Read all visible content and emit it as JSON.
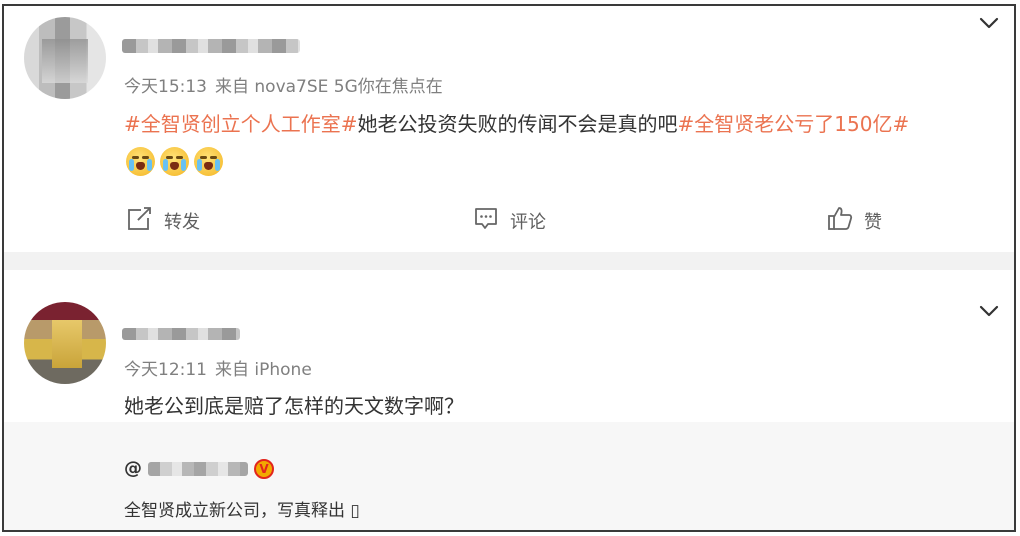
{
  "posts": [
    {
      "meta": {
        "time": "今天15:13",
        "source": "来自 nova7SE 5G你在焦点在"
      },
      "text": {
        "tag1": "#全智贤创立个人工作室#",
        "body": "她老公投资失败的传闻不会是真的吧",
        "tag2": "#全智贤老公亏了150亿#"
      },
      "emojis": [
        "crying-emoji",
        "crying-emoji",
        "crying-emoji"
      ],
      "actions": {
        "repost": "转发",
        "comment": "评论",
        "like": "赞"
      }
    },
    {
      "meta": {
        "time": "今天12:11",
        "source": "来自 iPhone"
      },
      "text": {
        "body": "她老公到底是赔了怎样的天文数字啊？"
      },
      "quote": {
        "at": "@",
        "badge": "V",
        "text": "全智贤成立新公司，写真释出 ▯"
      }
    }
  ],
  "colors": {
    "accent_tag": "#eb7350",
    "meta": "#7f7f7f",
    "separator": "#f2f2f2",
    "quote_bg": "#f7f7f7"
  },
  "icons": [
    "chevron-down-icon",
    "repost-icon",
    "comment-icon",
    "like-icon",
    "verified-badge-icon"
  ]
}
